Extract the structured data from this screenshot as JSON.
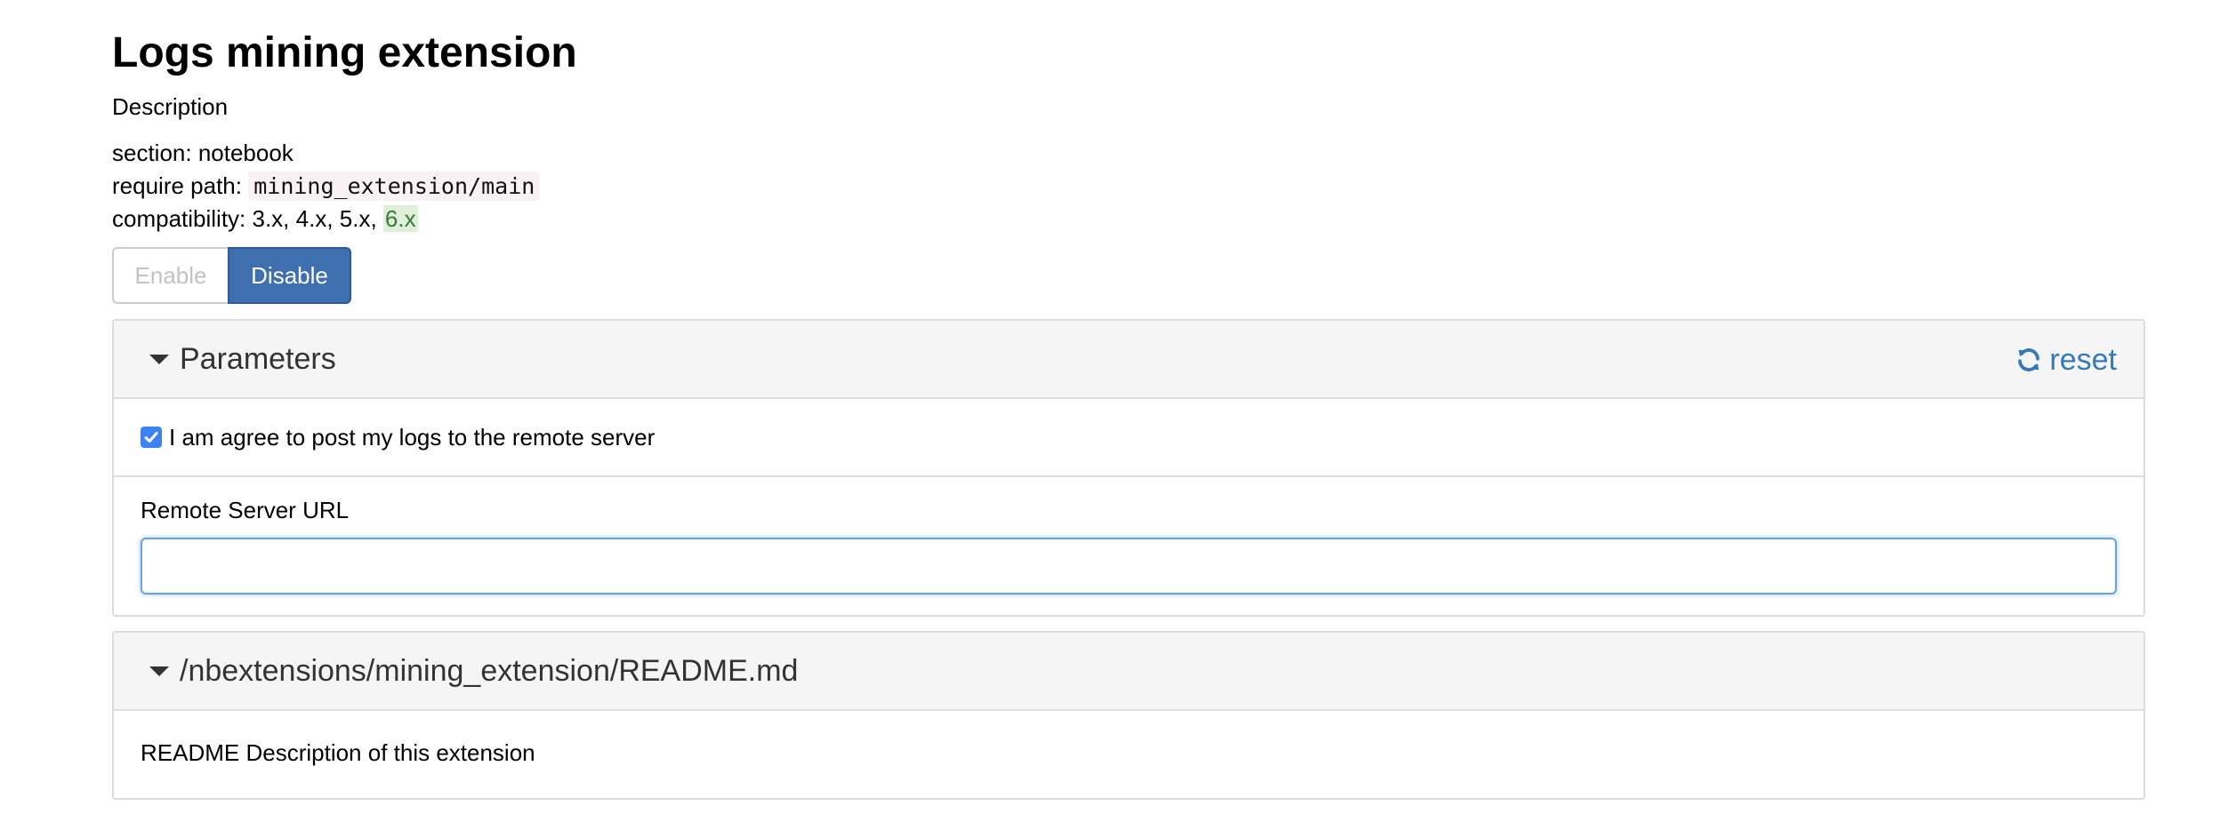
{
  "extension": {
    "title": "Logs mining extension",
    "description_label": "Description"
  },
  "meta": {
    "section_label": "section: ",
    "section_value": "notebook",
    "require_label": "require path: ",
    "require_value": "mining_extension/main",
    "compat_label": "compatibility: ",
    "compat_versions": "3.x, 4.x, 5.x, ",
    "compat_current": "6.x"
  },
  "actions": {
    "enable_label": "Enable",
    "disable_label": "Disable",
    "active": "disable"
  },
  "parameters": {
    "heading": "Parameters",
    "reset_label": "reset",
    "agree_checkbox": {
      "label": "I am agree to post my logs to the remote server",
      "checked": true
    },
    "remote_url": {
      "label": "Remote Server URL",
      "value": ""
    }
  },
  "readme": {
    "heading": "/nbextensions/mining_extension/README.md",
    "body": "README Description of this extension"
  },
  "colors": {
    "primary": "#3e6fae",
    "link": "#337ab7",
    "compat_highlight_bg": "#dff0d8",
    "compat_highlight_fg": "#3c763d"
  }
}
